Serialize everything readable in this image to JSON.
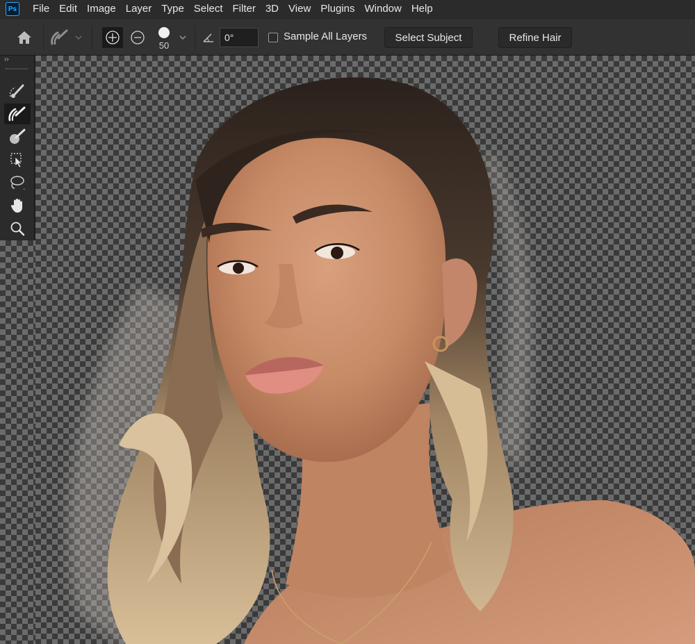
{
  "app": {
    "logo": "Ps"
  },
  "menu": [
    "File",
    "Edit",
    "Image",
    "Layer",
    "Type",
    "Select",
    "Filter",
    "3D",
    "View",
    "Plugins",
    "Window",
    "Help"
  ],
  "options": {
    "brush_size": "50",
    "angle_value": "0°",
    "sample_all_layers_label": "Sample All Layers",
    "sample_all_layers_checked": false,
    "select_subject_label": "Select Subject",
    "refine_hair_label": "Refine Hair"
  },
  "toolbar": {
    "expand_label": "››",
    "tools": [
      {
        "name": "quick-selection-tool",
        "icon": "quick-selection-icon",
        "active": false
      },
      {
        "name": "refine-edge-brush-tool",
        "icon": "refine-edge-brush-icon",
        "active": true
      },
      {
        "name": "brush-tool",
        "icon": "brush-icon",
        "active": false
      },
      {
        "name": "object-selection-tool",
        "icon": "object-selection-icon",
        "active": false
      },
      {
        "name": "lasso-tool",
        "icon": "lasso-icon",
        "active": false
      },
      {
        "name": "hand-tool",
        "icon": "hand-icon",
        "active": false
      },
      {
        "name": "zoom-tool",
        "icon": "zoom-icon",
        "active": false
      }
    ]
  },
  "colors": {
    "menubar": "#2b2b2b",
    "optionsbar": "#323232",
    "accent": "#31a8ff"
  }
}
